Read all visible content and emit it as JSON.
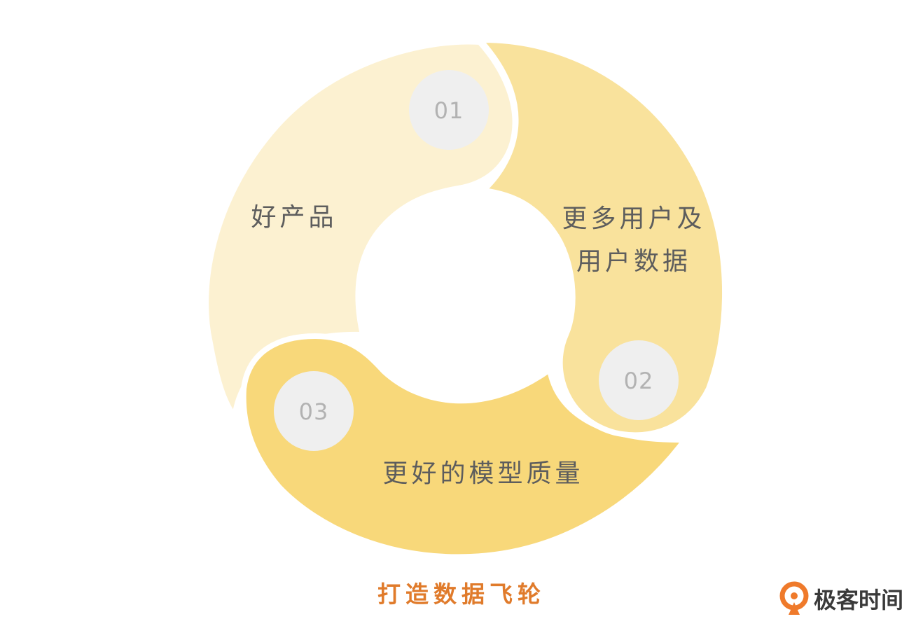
{
  "colors": {
    "segment_1": "#fcf1d1",
    "segment_2": "#f9e29c",
    "segment_3": "#f8d87a",
    "badge": "#efefef",
    "caption": "#e07b2b",
    "logo_mark": "#ef7a2b"
  },
  "segments": [
    {
      "number": "01",
      "label_lines": [
        "好产品"
      ]
    },
    {
      "number": "02",
      "label_lines": [
        "更多用户及",
        "用户数据"
      ]
    },
    {
      "number": "03",
      "label_lines": [
        "更好的模型质量"
      ]
    }
  ],
  "caption": "打造数据飞轮",
  "logo": {
    "icon": "geektime-logo-icon",
    "text": "极客时间"
  }
}
